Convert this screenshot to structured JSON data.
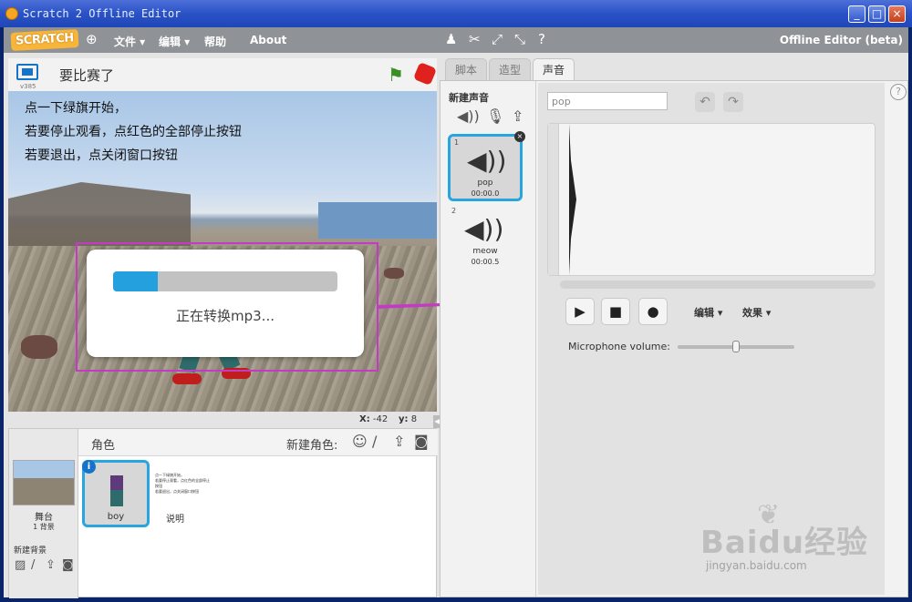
{
  "window": {
    "title": "Scratch 2 Offline Editor",
    "controls": {
      "minimize": "_",
      "maximize": "□",
      "close": "×"
    }
  },
  "menubar": {
    "logo": "SCRATCH",
    "items": [
      "文件 ▾",
      "编辑 ▾",
      "帮助",
      "About"
    ],
    "edition": "Offline Editor (beta)"
  },
  "stage": {
    "version": "v385",
    "project_title": "要比赛了",
    "instructions": [
      "点一下绿旗开始，",
      "若要停止观看，点红色的全部停止按钮",
      "若要退出，点关闭窗口按钮"
    ],
    "coords": {
      "x_label": "X:",
      "x_value": "-42",
      "y_label": "y:",
      "y_value": "8"
    }
  },
  "dialog": {
    "progress": 0.2,
    "message": "正在转换mp3..."
  },
  "sprites": {
    "header_label": "角色",
    "new_sprite_label": "新建角色:",
    "stage_name": "舞台",
    "stage_backdrops": "1 背景",
    "new_backdrop_label": "新建背景",
    "items": [
      {
        "name": "boy"
      },
      {
        "name": "说明"
      }
    ],
    "notes_lines": [
      "点一下绿旗开始，",
      "若要停止观看，点红色的全部停止按钮",
      "若要退出，点关闭窗口按钮"
    ]
  },
  "tabs": [
    "脚本",
    "造型",
    "声音"
  ],
  "sounds": {
    "new_sound_label": "新建声音",
    "items": [
      {
        "number": "1",
        "name": "pop",
        "duration": "00:00.0"
      },
      {
        "number": "2",
        "name": "meow",
        "duration": "00:00.5"
      }
    ]
  },
  "editor": {
    "name_value": "pop",
    "edit_menu": "编辑 ▾",
    "effects_menu": "效果 ▾",
    "mic_label": "Microphone volume:",
    "mic_volume": 0.5
  },
  "watermark": {
    "logo": "Baidu经验",
    "url": "jingyan.baidu.com"
  },
  "colors": {
    "accent": "#27a5de",
    "progress": "#23a0dd",
    "highlight": "#c33bc3",
    "stop": "#e0221e",
    "flag": "#3a8f25"
  }
}
